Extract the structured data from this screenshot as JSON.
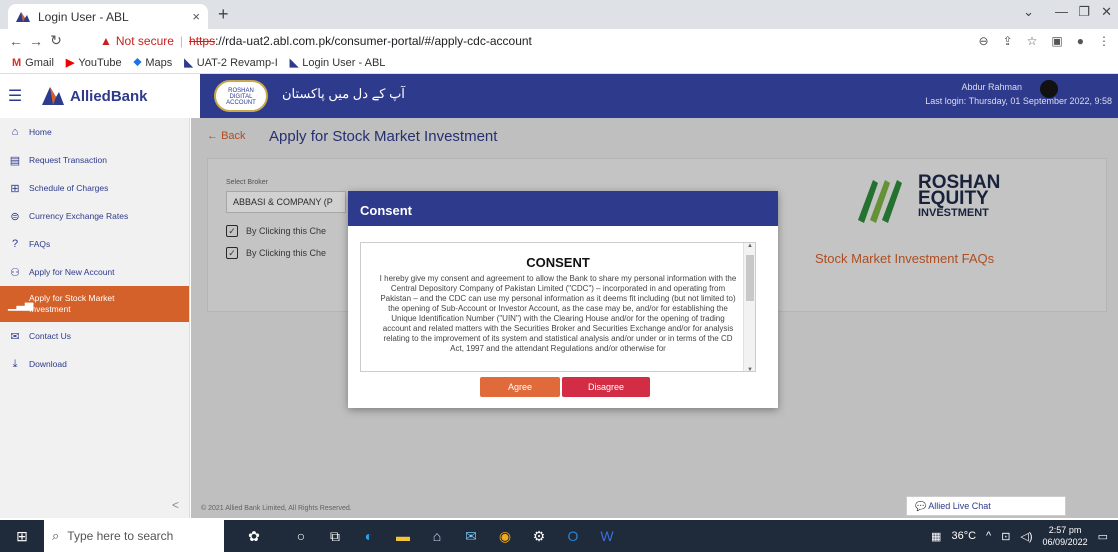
{
  "browser": {
    "tab_title": "Login User - ABL",
    "tab_close": "×",
    "new_tab": "+",
    "security_label": "Not secure",
    "url_scheme": "https",
    "url_rest": "://rda-uat2.abl.com.pk/consumer-portal/#/apply-cdc-account",
    "bookmarks": [
      "Gmail",
      "YouTube",
      "Maps",
      "UAT-2 Revamp-I",
      "Login User - ABL"
    ]
  },
  "app": {
    "brand": "AlliedBank",
    "rda_logo_text": "ROSHAN DIGITAL ACCOUNT",
    "urdu_tagline": "آپ کے دل میں پاکستان",
    "user_name": "Abdur Rahman",
    "last_login": "Last login: Thursday, 01 September 2022, 9:58"
  },
  "sidebar": {
    "items": [
      {
        "label": "Home",
        "icon": "home-icon"
      },
      {
        "label": "Request Transaction",
        "icon": "transaction-icon"
      },
      {
        "label": "Schedule of Charges",
        "icon": "grid-icon"
      },
      {
        "label": "Currency Exchange Rates",
        "icon": "currency-icon"
      },
      {
        "label": "FAQs",
        "icon": "help-icon"
      },
      {
        "label": "Apply for New Account",
        "icon": "people-icon"
      },
      {
        "label": "Apply for Stock Market Investment",
        "icon": "chart-icon"
      },
      {
        "label": "Contact Us",
        "icon": "mail-icon"
      },
      {
        "label": "Download",
        "icon": "download-icon"
      }
    ],
    "collapse": "<"
  },
  "main": {
    "back": "Back",
    "title": "Apply for Stock Market Investment",
    "broker_label": "Select Broker",
    "broker_value": "ABBASI & COMPANY (P",
    "checkbox_1": "By Clicking this Che",
    "checkbox_2": "By Clicking this Che",
    "logo_line1": "ROSHAN",
    "logo_line2": "EQUITY",
    "logo_line3": "INVESTMENT",
    "faq_link": "Stock Market Investment FAQs",
    "footer": "© 2021 Allied Bank Limited, All Rights Reserved."
  },
  "modal": {
    "header": "Consent",
    "title": "CONSENT",
    "text": "I hereby give my consent and agreement to allow the Bank to share my personal information with the Central Depository Company of Pakistan Limited (\"CDC\") – incorporated in and operating from Pakistan – and the CDC can use my personal information as it deems fit including (but not limited to) the opening of Sub-Account or Investor Account, as the case may be, and/or for establishing the Unique Identification Number (\"UIN\") with the Clearing House and/or for the opening of trading account and related matters with the Securities Broker and Securities Exchange and/or for analysis relating to the improvement of its system and statistical analysis and/or under or in terms of the CD Act, 1997 and the attendant Regulations and/or otherwise for",
    "agree": "Agree",
    "disagree": "Disagree"
  },
  "chat": {
    "label": "Allied Live Chat"
  },
  "taskbar": {
    "search_placeholder": "Type here to search",
    "weather": "36°C",
    "time": "2:57 pm",
    "date": "06/09/2022"
  },
  "colors": {
    "primary": "#2e3a8c",
    "accent": "#d4602a",
    "danger": "#d22d45"
  }
}
